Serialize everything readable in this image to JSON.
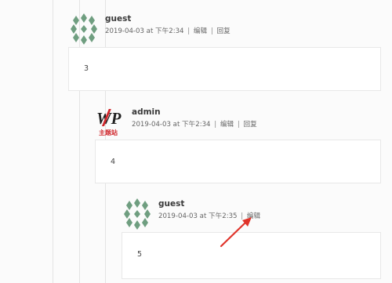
{
  "comments": [
    {
      "author": "guest",
      "date": "2019-04-03 at 下午2:34",
      "actions": [
        "编辑",
        "回复"
      ],
      "body": "3",
      "avatar": "identicon-avatar"
    },
    {
      "author": "admin",
      "date": "2019-04-03 at 下午2:34",
      "actions": [
        "编辑",
        "回复"
      ],
      "body": "4",
      "avatar": "wp-logo-avatar",
      "logo_text": "WP",
      "logo_subtext": "主题站"
    },
    {
      "author": "guest",
      "date": "2019-04-03 at 下午2:35",
      "actions": [
        "编辑"
      ],
      "body": "5",
      "avatar": "identicon-avatar"
    }
  ],
  "colors": {
    "identicon": "#6f9e80",
    "logo_red": "#d0262b",
    "arrow_red": "#e0332a"
  }
}
